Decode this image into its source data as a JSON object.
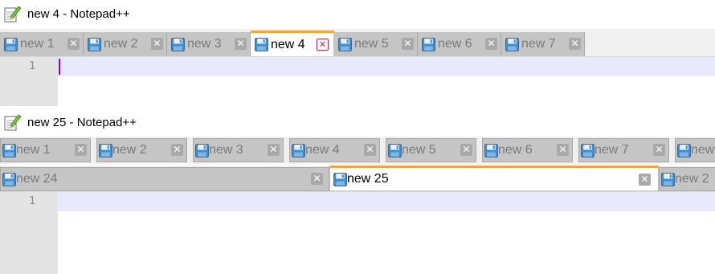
{
  "window1": {
    "title": "new 4 - Notepad++",
    "tabs": [
      {
        "label": "new 1",
        "active": false
      },
      {
        "label": "new 2",
        "active": false
      },
      {
        "label": "new 3",
        "active": false
      },
      {
        "label": "new 4",
        "active": true
      },
      {
        "label": "new 5",
        "active": false
      },
      {
        "label": "new 6",
        "active": false
      },
      {
        "label": "new 7",
        "active": false
      }
    ],
    "editor": {
      "line_number": "1"
    }
  },
  "window2": {
    "title": "new 25 - Notepad++",
    "tabs_row1": [
      {
        "label": "new 1"
      },
      {
        "label": "new 2"
      },
      {
        "label": "new 3"
      },
      {
        "label": "new 4"
      },
      {
        "label": "new 5"
      },
      {
        "label": "new 6"
      },
      {
        "label": "new 7"
      },
      {
        "label": "new"
      }
    ],
    "tabs_row2": [
      {
        "label": "new 24",
        "active": false
      },
      {
        "label": "new 25",
        "active": true
      },
      {
        "label": "new 2",
        "active": false
      }
    ],
    "editor": {
      "line_number": "1"
    }
  },
  "icons": {
    "app": "notepad-plus-plus-icon",
    "tab_file": "floppy-disk-icon",
    "close": "close-icon"
  },
  "colors": {
    "active_tab_accent": "#f6a33a",
    "active_close": "#b02c46",
    "current_line": "#e8e8ff",
    "caret": "#8000ff"
  }
}
